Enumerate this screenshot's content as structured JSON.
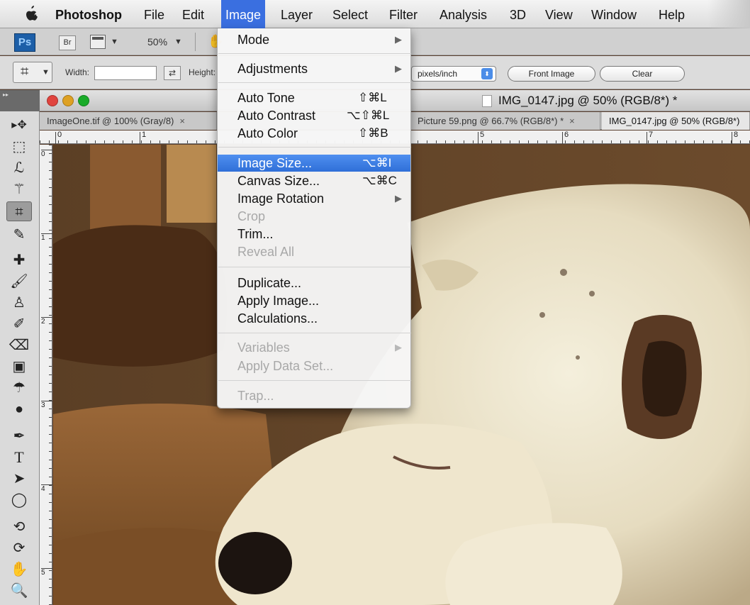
{
  "menubar": {
    "apple_icon": "apple-icon",
    "items": [
      {
        "label": "Photoshop"
      },
      {
        "label": "File"
      },
      {
        "label": "Edit"
      },
      {
        "label": "Image"
      },
      {
        "label": "Layer"
      },
      {
        "label": "Select"
      },
      {
        "label": "Filter"
      },
      {
        "label": "Analysis"
      },
      {
        "label": "3D"
      },
      {
        "label": "View"
      },
      {
        "label": "Window"
      },
      {
        "label": "Help"
      }
    ]
  },
  "appbar": {
    "ps_label": "Ps",
    "br_label": "Br",
    "zoom": "50%"
  },
  "options": {
    "width_label": "Width:",
    "height_label": "Height:",
    "units": "pixels/inch",
    "front_image": "Front Image",
    "clear": "Clear"
  },
  "document": {
    "title": "IMG_0147.jpg @ 50% (RGB/8*) *",
    "tabs": [
      {
        "label": "ImageOne.tif @ 100% (Gray/8)",
        "close": "×"
      },
      {
        "label": "Picture 59.png @ 66.7% (RGB/8*) *",
        "close": "×"
      },
      {
        "label": "IMG_0147.jpg @ 50% (RGB/8*)"
      }
    ],
    "ruler_h": [
      "0",
      "1",
      "5",
      "6",
      "7",
      "8"
    ],
    "ruler_v": [
      "0",
      "1",
      "2",
      "3",
      "4",
      "5"
    ]
  },
  "image_menu": {
    "items": [
      {
        "label": "Mode",
        "submenu": true
      },
      {
        "label": "Adjustments",
        "submenu": true
      },
      {
        "label": "Auto Tone",
        "shortcut": "⇧⌘L"
      },
      {
        "label": "Auto Contrast",
        "shortcut": "⌥⇧⌘L"
      },
      {
        "label": "Auto Color",
        "shortcut": "⇧⌘B"
      },
      {
        "label": "Image Size...",
        "shortcut": "⌥⌘I",
        "highlighted": true
      },
      {
        "label": "Canvas Size...",
        "shortcut": "⌥⌘C"
      },
      {
        "label": "Image Rotation",
        "submenu": true
      },
      {
        "label": "Crop",
        "disabled": true
      },
      {
        "label": "Trim..."
      },
      {
        "label": "Reveal All",
        "disabled": true
      },
      {
        "label": "Duplicate..."
      },
      {
        "label": "Apply Image..."
      },
      {
        "label": "Calculations..."
      },
      {
        "label": "Variables",
        "submenu": true,
        "disabled": true
      },
      {
        "label": "Apply Data Set...",
        "disabled": true
      },
      {
        "label": "Trap...",
        "disabled": true
      }
    ],
    "arrow": "▶"
  },
  "colors": {
    "menu_highlight": "#3a6fe0",
    "traffic_close": "#e0443e",
    "traffic_min": "#dea123",
    "traffic_zoom": "#1aab29"
  }
}
